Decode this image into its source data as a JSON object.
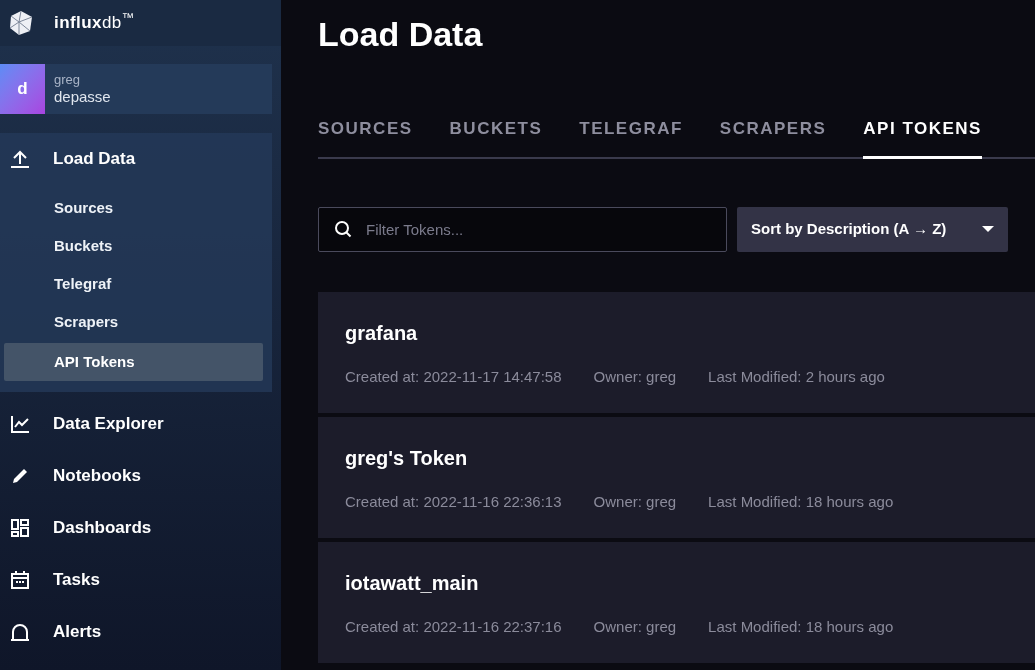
{
  "logo": {
    "text": "**influx**db$^{™}$"
  },
  "profile": {
    "initial": "d",
    "user": "greg",
    "org": "depasse"
  },
  "sidebar": {
    "active_section": {
      "label": "Load Data",
      "items": [
        {
          "label": "Sources",
          "selected": false
        },
        {
          "label": "Buckets",
          "selected": false
        },
        {
          "label": "Telegraf",
          "selected": false
        },
        {
          "label": "Scrapers",
          "selected": false
        },
        {
          "label": "API Tokens",
          "selected": true
        }
      ]
    },
    "items": [
      {
        "label": "Data Explorer"
      },
      {
        "label": "Notebooks"
      },
      {
        "label": "Dashboards"
      },
      {
        "label": "Tasks"
      },
      {
        "label": "Alerts"
      }
    ]
  },
  "page": {
    "title": "Load Data"
  },
  "tabs": [
    {
      "label": "SOURCES",
      "selected": false
    },
    {
      "label": "BUCKETS",
      "selected": false
    },
    {
      "label": "TELEGRAF",
      "selected": false
    },
    {
      "label": "SCRAPERS",
      "selected": false
    },
    {
      "label": "API TOKENS",
      "selected": true
    }
  ],
  "filter": {
    "placeholder": "Filter Tokens..."
  },
  "sort": {
    "label": "Sort by Description (A → Z)"
  },
  "tokens": [
    {
      "name": "grafana",
      "created": "Created at: 2022-11-17 14:47:58",
      "owner": "Owner: greg",
      "modified": "Last Modified: 2 hours ago"
    },
    {
      "name": "greg's Token",
      "created": "Created at: 2022-11-16 22:36:13",
      "owner": "Owner: greg",
      "modified": "Last Modified: 18 hours ago"
    },
    {
      "name": "iotawatt_main",
      "created": "Created at: 2022-11-16 22:37:16",
      "owner": "Owner: greg",
      "modified": "Last Modified: 18 hours ago"
    }
  ]
}
